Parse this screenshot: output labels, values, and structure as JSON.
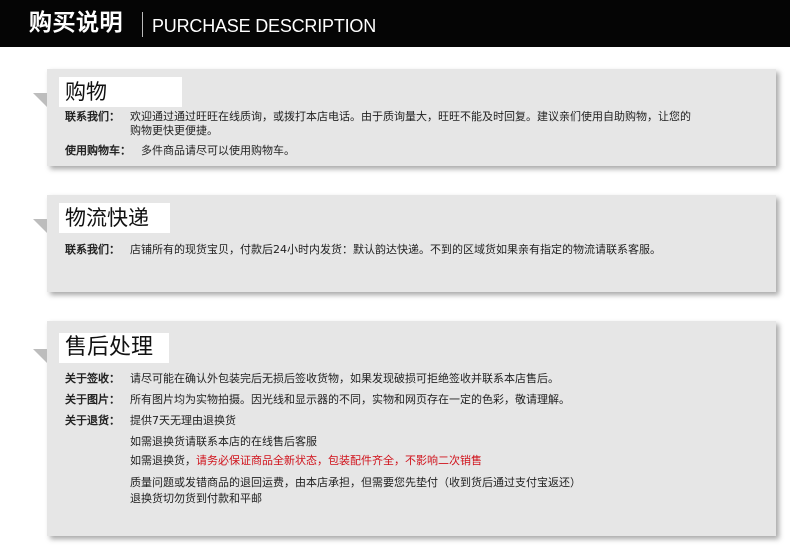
{
  "header": {
    "title_cn": "购买说明",
    "title_en": "PURCHASE DESCRIPTION"
  },
  "shopping": {
    "title": "购物",
    "contact_key": "联系我们：",
    "contact_val_1": "欢迎通过通过旺旺在线质询，或拨打本店电话。由于质询量大，旺旺不能及时回复。建议亲们使用自助购物，让您的",
    "contact_val_2": "购物更快更便捷。",
    "cart_key": "使用购物车：",
    "cart_val": "多件商品请尽可以使用购物车。"
  },
  "logistics": {
    "title": "物流快递",
    "contact_key": "联系我们：",
    "contact_val": "店铺所有的现货宝贝，付款后24小时内发货：默认韵达快递。不到的区域货如果亲有指定的物流请联系客服。"
  },
  "after_sales": {
    "title": "售后处理",
    "sign_key": "关于签收：",
    "sign_val": "请尽可能在确认外包装完后无损后签收货物，如果发现破损可拒绝签收并联系本店售后。",
    "pic_key": "关于图片：",
    "pic_val": "所有图片均为实物拍摄。因光线和显示器的不同，实物和网页存在一定的色彩，敬请理解。",
    "return_key": "关于退货：",
    "return_1": "提供7天无理由退换货",
    "return_2": "如需退换货请联系本店的在线售后客服",
    "return_3_prefix": "如需退换货，",
    "return_3_red": "请务必保证商品全新状态，包装配件齐全，不影响二次销售",
    "return_4": "质量问题或发错商品的退回运费，由本店承担，但需要您先垫付（收到货后通过支付宝返还）",
    "return_5_red": "退换货切勿货到付款和平邮"
  }
}
